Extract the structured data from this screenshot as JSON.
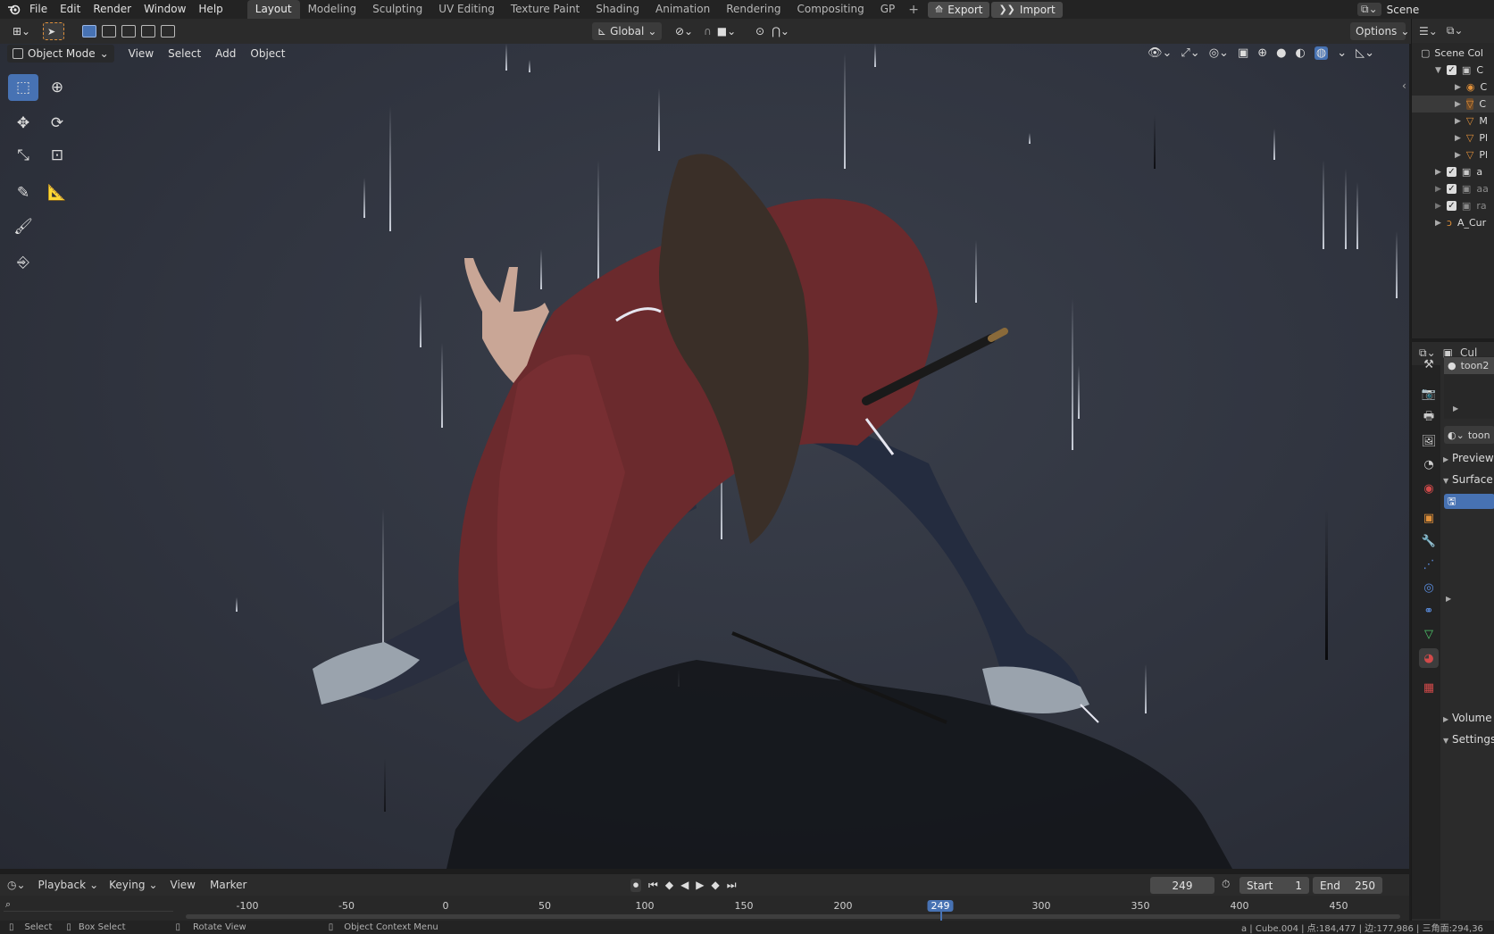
{
  "topbar": {
    "menus": [
      "File",
      "Edit",
      "Render",
      "Window",
      "Help"
    ],
    "workspace_tabs": [
      "Layout",
      "Modeling",
      "Sculpting",
      "UV Editing",
      "Texture Paint",
      "Shading",
      "Animation",
      "Rendering",
      "Compositing",
      "GP"
    ],
    "active_tab": "Layout",
    "add_tab": "+",
    "export_label": "Export",
    "import_label": "Import",
    "scene_label": "Scene"
  },
  "toolheader": {
    "orientation": "Global",
    "options_label": "Options"
  },
  "viewport": {
    "mode": "Object Mode",
    "menus": [
      "View",
      "Select",
      "Add",
      "Object"
    ]
  },
  "outliner": {
    "scene_collection": "Scene Col",
    "rows": [
      {
        "label": "C",
        "icon": "collection-icon",
        "color": "#c8c8c8"
      },
      {
        "label": "C",
        "icon": "camera-icon",
        "color": "#e0903a"
      },
      {
        "label": "C",
        "icon": "mesh-icon",
        "color": "#e0903a"
      },
      {
        "label": "M",
        "icon": "mesh-icon",
        "color": "#e0903a"
      },
      {
        "label": "Pl",
        "icon": "mesh-icon",
        "color": "#e0903a"
      },
      {
        "label": "Pl",
        "icon": "mesh-icon",
        "color": "#e0903a"
      },
      {
        "label": "a",
        "icon": "collection-icon",
        "color": "#c8c8c8"
      },
      {
        "label": "aa",
        "icon": "collection-icon",
        "color": "#8a8a8a"
      },
      {
        "label": "ra",
        "icon": "collection-icon",
        "color": "#8a8a8a"
      },
      {
        "label": "A_Cur",
        "icon": "curve-icon",
        "color": "#e0903a"
      }
    ]
  },
  "properties": {
    "object_name": "Cul",
    "material_slot": "toon2",
    "material_name": "toon",
    "panels": [
      "Preview",
      "Surface",
      "Volume",
      "Settings"
    ]
  },
  "timeline": {
    "menus": [
      "Playback",
      "Keying",
      "View",
      "Marker"
    ],
    "current_frame": "249",
    "start_label": "Start",
    "start_value": "1",
    "end_label": "End",
    "end_value": "250",
    "ruler": [
      "-100",
      "-50",
      "0",
      "50",
      "100",
      "150",
      "200",
      "249",
      "300",
      "350",
      "400",
      "450"
    ]
  },
  "statusbar": {
    "select": "Select",
    "box_select": "Box Select",
    "rotate_view": "Rotate View",
    "context_menu": "Object Context Menu",
    "stats": "a | Cube.004 | 点:184,477 | 边:177,986 | 三角面:294,36"
  },
  "colors": {
    "accent": "#4772b3",
    "active_frame": "#4772b3",
    "object_orange": "#e0903a"
  }
}
